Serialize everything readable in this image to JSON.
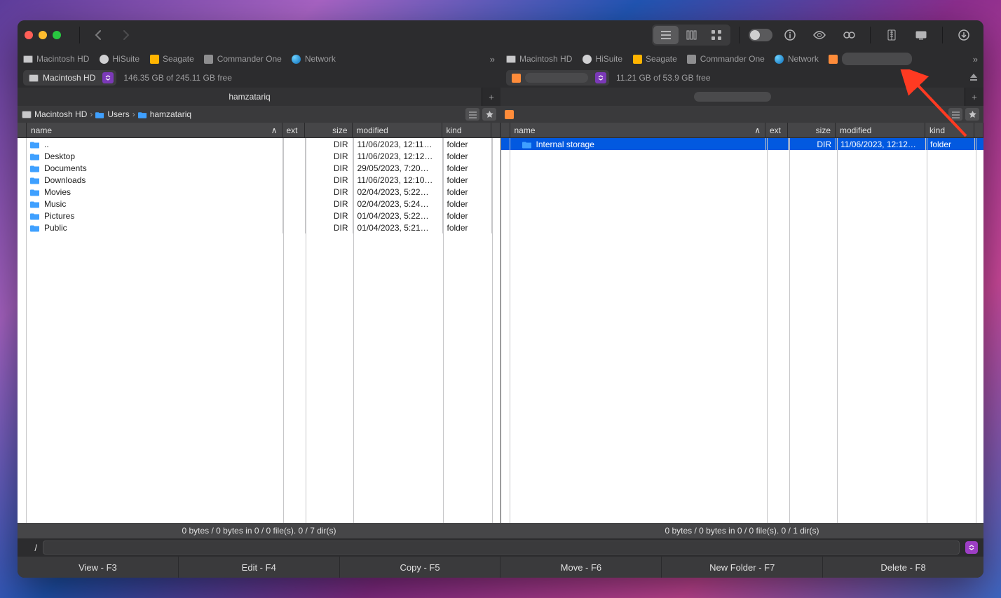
{
  "favorites": [
    "Macintosh HD",
    "HiSuite",
    "Seagate",
    "Commander One",
    "Network"
  ],
  "left": {
    "disk_label": "Macintosh HD",
    "disk_free": "146.35 GB of 245.11 GB free",
    "tab": "hamzatariq",
    "crumbs": [
      "Macintosh HD",
      "Users",
      "hamzatariq"
    ],
    "columns": {
      "name": "name",
      "ext": "ext",
      "size": "size",
      "mod": "modified",
      "kind": "kind"
    },
    "rows": [
      {
        "name": "..",
        "size": "DIR",
        "mod": "11/06/2023, 12:11…",
        "kind": "folder"
      },
      {
        "name": "Desktop",
        "size": "DIR",
        "mod": "11/06/2023, 12:12…",
        "kind": "folder"
      },
      {
        "name": "Documents",
        "size": "DIR",
        "mod": "29/05/2023, 7:20…",
        "kind": "folder"
      },
      {
        "name": "Downloads",
        "size": "DIR",
        "mod": "11/06/2023, 12:10…",
        "kind": "folder"
      },
      {
        "name": "Movies",
        "size": "DIR",
        "mod": "02/04/2023, 5:22…",
        "kind": "folder"
      },
      {
        "name": "Music",
        "size": "DIR",
        "mod": "02/04/2023, 5:24…",
        "kind": "folder"
      },
      {
        "name": "Pictures",
        "size": "DIR",
        "mod": "01/04/2023, 5:22…",
        "kind": "folder"
      },
      {
        "name": "Public",
        "size": "DIR",
        "mod": "01/04/2023, 5:21…",
        "kind": "folder"
      }
    ],
    "status": "0 bytes / 0 bytes in 0 / 0 file(s). 0 / 7 dir(s)"
  },
  "right": {
    "disk_free": "11.21 GB of 53.9 GB free",
    "columns": {
      "name": "name",
      "ext": "ext",
      "size": "size",
      "mod": "modified",
      "kind": "kind"
    },
    "rows": [
      {
        "name": "Internal storage",
        "size": "DIR",
        "mod": "11/06/2023, 12:12…",
        "kind": "folder",
        "selected": true
      }
    ],
    "status": "0 bytes / 0 bytes in 0 / 0 file(s). 0 / 1 dir(s)"
  },
  "cmd_path": "/",
  "fnkeys": [
    "View - F3",
    "Edit - F4",
    "Copy - F5",
    "Move - F6",
    "New Folder - F7",
    "Delete - F8"
  ]
}
